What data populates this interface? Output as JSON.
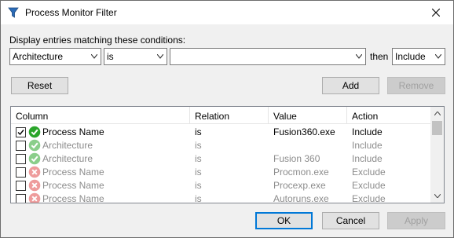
{
  "window": {
    "title": "Process Monitor Filter"
  },
  "conditions": {
    "label": "Display entries matching these conditions:",
    "column_value": "Architecture",
    "relation_value": "is",
    "value_text": "",
    "then_label": "then",
    "action_value": "Include"
  },
  "buttons": {
    "reset": "Reset",
    "add": "Add",
    "remove": "Remove",
    "ok": "OK",
    "cancel": "Cancel",
    "apply": "Apply"
  },
  "list": {
    "headers": [
      "Column",
      "Relation",
      "Value",
      "Action"
    ],
    "rows": [
      {
        "checked": true,
        "status": "include",
        "column": "Process Name",
        "relation": "is",
        "value": "Fusion360.exe",
        "action": "Include"
      },
      {
        "checked": false,
        "status": "include",
        "column": "Architecture",
        "relation": "is",
        "value": "",
        "action": "Include"
      },
      {
        "checked": false,
        "status": "include",
        "column": "Architecture",
        "relation": "is",
        "value": "Fusion 360",
        "action": "Include"
      },
      {
        "checked": false,
        "status": "exclude",
        "column": "Process Name",
        "relation": "is",
        "value": "Procmon.exe",
        "action": "Exclude"
      },
      {
        "checked": false,
        "status": "exclude",
        "column": "Process Name",
        "relation": "is",
        "value": "Procexp.exe",
        "action": "Exclude"
      },
      {
        "checked": false,
        "status": "exclude",
        "column": "Process Name",
        "relation": "is",
        "value": "Autoruns.exe",
        "action": "Exclude"
      }
    ]
  },
  "icons": {
    "window": "filter-icon",
    "close": "close-icon",
    "include": "check-circle-icon",
    "exclude": "x-circle-icon"
  },
  "colors": {
    "include": "#2aa52a",
    "exclude": "#e04848",
    "accent": "#0078d7"
  }
}
